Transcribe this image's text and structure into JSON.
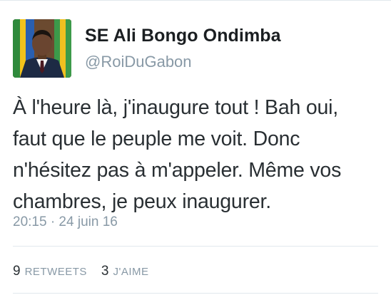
{
  "user": {
    "display_name": "SE Ali Bongo Ondimba",
    "handle": "@RoiDuGabon",
    "avatar_icon": "profile-photo"
  },
  "tweet": {
    "lines": [
      "À l'heure là, j'inaugure tout ! Bah oui,",
      "faut que le peuple me voit. Donc",
      "n'hésitez pas à m'appeler. Même vos",
      "chambres, je peux inaugurer."
    ],
    "timestamp": "20:15 · 24 juin 16"
  },
  "stats": {
    "retweets_count": "9",
    "retweets_label": "RETWEETS",
    "likes_count": "3",
    "likes_label": "J'AIME"
  },
  "colors": {
    "text": "#292f33",
    "muted": "#8899a6",
    "divider": "#e1e8ed"
  }
}
